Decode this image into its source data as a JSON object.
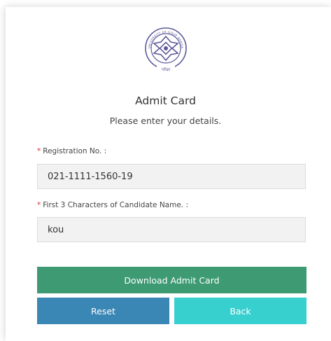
{
  "logo": {
    "icon": "university-seal-icon",
    "text_top": "UNIVERSITY OF GOUR BANGA",
    "text_bottom": "परीक्षा"
  },
  "header": {
    "title": "Admit Card",
    "subtitle": "Please enter your details."
  },
  "form": {
    "registration": {
      "required_mark": "*",
      "label": "Registration No. :",
      "value": "021-1111-1560-19"
    },
    "candidate_name": {
      "required_mark": "*",
      "label": "First 3 Characters of Candidate Name. :",
      "value": "kou"
    }
  },
  "buttons": {
    "download": "Download Admit Card",
    "reset": "Reset",
    "back": "Back"
  },
  "colors": {
    "download": "#3d9a73",
    "reset": "#3a86b5",
    "back": "#38cfcf",
    "required": "#e03030",
    "seal": "#5a5a9a"
  }
}
